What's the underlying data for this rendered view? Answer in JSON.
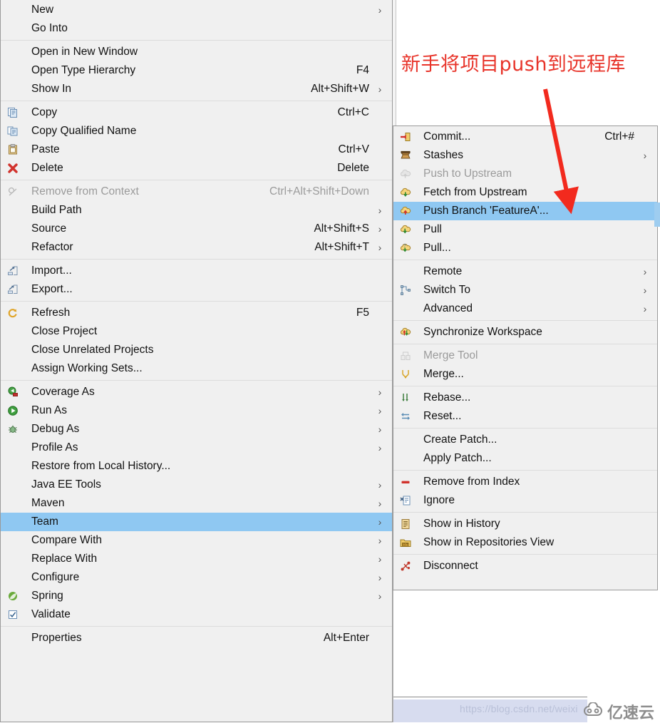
{
  "annotation": {
    "text": "新手将项目push到远程库",
    "color": "#e8342a"
  },
  "colors": {
    "menu_bg": "#f0f0f0",
    "menu_border": "#9a9a9a",
    "highlight": "#8fc8f2",
    "separator": "#dcdcdc",
    "disabled_text": "#9b9b9b",
    "text": "#111111",
    "annotation_red": "#e8342a",
    "status_strip": "#d7dcef",
    "watermark": "#b9c0d8"
  },
  "context_menu": {
    "name": "project-context-menu",
    "items": [
      {
        "label": "New",
        "accel": "",
        "submenu": true,
        "icon": "",
        "disabled": false,
        "selected": false
      },
      {
        "label": "Go Into",
        "accel": "",
        "submenu": false,
        "icon": "",
        "disabled": false,
        "selected": false
      },
      {
        "separator": true
      },
      {
        "label": "Open in New Window",
        "accel": "",
        "submenu": false,
        "icon": "",
        "disabled": false,
        "selected": false
      },
      {
        "label": "Open Type Hierarchy",
        "accel": "F4",
        "submenu": false,
        "icon": "",
        "disabled": false,
        "selected": false
      },
      {
        "label": "Show In",
        "accel": "Alt+Shift+W",
        "submenu": true,
        "icon": "",
        "disabled": false,
        "selected": false
      },
      {
        "separator": true
      },
      {
        "label": "Copy",
        "accel": "Ctrl+C",
        "submenu": false,
        "icon": "copy-icon",
        "disabled": false,
        "selected": false
      },
      {
        "label": "Copy Qualified Name",
        "accel": "",
        "submenu": false,
        "icon": "copy-qualified-icon",
        "disabled": false,
        "selected": false
      },
      {
        "label": "Paste",
        "accel": "Ctrl+V",
        "submenu": false,
        "icon": "paste-icon",
        "disabled": false,
        "selected": false
      },
      {
        "label": "Delete",
        "accel": "Delete",
        "submenu": false,
        "icon": "delete-x-icon",
        "disabled": false,
        "selected": false
      },
      {
        "separator": true
      },
      {
        "label": "Remove from Context",
        "accel": "Ctrl+Alt+Shift+Down",
        "submenu": false,
        "icon": "remove-context-icon",
        "disabled": true,
        "selected": false
      },
      {
        "label": "Build Path",
        "accel": "",
        "submenu": true,
        "icon": "",
        "disabled": false,
        "selected": false
      },
      {
        "label": "Source",
        "accel": "Alt+Shift+S",
        "submenu": true,
        "icon": "",
        "disabled": false,
        "selected": false
      },
      {
        "label": "Refactor",
        "accel": "Alt+Shift+T",
        "submenu": true,
        "icon": "",
        "disabled": false,
        "selected": false
      },
      {
        "separator": true
      },
      {
        "label": "Import...",
        "accel": "",
        "submenu": false,
        "icon": "import-icon",
        "disabled": false,
        "selected": false
      },
      {
        "label": "Export...",
        "accel": "",
        "submenu": false,
        "icon": "export-icon",
        "disabled": false,
        "selected": false
      },
      {
        "separator": true
      },
      {
        "label": "Refresh",
        "accel": "F5",
        "submenu": false,
        "icon": "refresh-icon",
        "disabled": false,
        "selected": false
      },
      {
        "label": "Close Project",
        "accel": "",
        "submenu": false,
        "icon": "",
        "disabled": false,
        "selected": false
      },
      {
        "label": "Close Unrelated Projects",
        "accel": "",
        "submenu": false,
        "icon": "",
        "disabled": false,
        "selected": false
      },
      {
        "label": "Assign Working Sets...",
        "accel": "",
        "submenu": false,
        "icon": "",
        "disabled": false,
        "selected": false
      },
      {
        "separator": true
      },
      {
        "label": "Coverage As",
        "accel": "",
        "submenu": true,
        "icon": "coverage-icon",
        "disabled": false,
        "selected": false
      },
      {
        "label": "Run As",
        "accel": "",
        "submenu": true,
        "icon": "run-icon",
        "disabled": false,
        "selected": false
      },
      {
        "label": "Debug As",
        "accel": "",
        "submenu": true,
        "icon": "debug-bug-icon",
        "disabled": false,
        "selected": false
      },
      {
        "label": "Profile As",
        "accel": "",
        "submenu": true,
        "icon": "",
        "disabled": false,
        "selected": false
      },
      {
        "label": "Restore from Local History...",
        "accel": "",
        "submenu": false,
        "icon": "",
        "disabled": false,
        "selected": false
      },
      {
        "label": "Java EE Tools",
        "accel": "",
        "submenu": true,
        "icon": "",
        "disabled": false,
        "selected": false
      },
      {
        "label": "Maven",
        "accel": "",
        "submenu": true,
        "icon": "",
        "disabled": false,
        "selected": false
      },
      {
        "label": "Team",
        "accel": "",
        "submenu": true,
        "icon": "",
        "disabled": false,
        "selected": true
      },
      {
        "label": "Compare With",
        "accel": "",
        "submenu": true,
        "icon": "",
        "disabled": false,
        "selected": false
      },
      {
        "label": "Replace With",
        "accel": "",
        "submenu": true,
        "icon": "",
        "disabled": false,
        "selected": false
      },
      {
        "label": "Configure",
        "accel": "",
        "submenu": true,
        "icon": "",
        "disabled": false,
        "selected": false
      },
      {
        "label": "Spring",
        "accel": "",
        "submenu": true,
        "icon": "spring-leaf-icon",
        "disabled": false,
        "selected": false
      },
      {
        "label": "Validate",
        "accel": "",
        "submenu": false,
        "icon": "validate-check-icon",
        "disabled": false,
        "selected": false
      },
      {
        "separator": true
      },
      {
        "label": "Properties",
        "accel": "Alt+Enter",
        "submenu": false,
        "icon": "",
        "disabled": false,
        "selected": false
      }
    ]
  },
  "team_submenu": {
    "name": "team-submenu",
    "items": [
      {
        "label": "Commit...",
        "accel": "Ctrl+#",
        "submenu": false,
        "icon": "commit-icon",
        "disabled": false,
        "selected": false
      },
      {
        "label": "Stashes",
        "accel": "",
        "submenu": true,
        "icon": "stash-box-icon",
        "disabled": false,
        "selected": false
      },
      {
        "label": "Push to Upstream",
        "accel": "",
        "submenu": false,
        "icon": "push-upstream-icon",
        "disabled": true,
        "selected": false
      },
      {
        "label": "Fetch from Upstream",
        "accel": "",
        "submenu": false,
        "icon": "fetch-icon",
        "disabled": false,
        "selected": false
      },
      {
        "label": "Push Branch 'FeatureA'...",
        "accel": "",
        "submenu": false,
        "icon": "push-branch-icon",
        "disabled": false,
        "selected": true
      },
      {
        "label": "Pull",
        "accel": "",
        "submenu": false,
        "icon": "pull-icon",
        "disabled": false,
        "selected": false
      },
      {
        "label": "Pull...",
        "accel": "",
        "submenu": false,
        "icon": "pull-options-icon",
        "disabled": false,
        "selected": false
      },
      {
        "separator": true
      },
      {
        "label": "Remote",
        "accel": "",
        "submenu": true,
        "icon": "",
        "disabled": false,
        "selected": false
      },
      {
        "label": "Switch To",
        "accel": "",
        "submenu": true,
        "icon": "switch-branch-icon",
        "disabled": false,
        "selected": false
      },
      {
        "label": "Advanced",
        "accel": "",
        "submenu": true,
        "icon": "",
        "disabled": false,
        "selected": false
      },
      {
        "separator": true
      },
      {
        "label": "Synchronize Workspace",
        "accel": "",
        "submenu": false,
        "icon": "synchronize-icon",
        "disabled": false,
        "selected": false
      },
      {
        "separator": true
      },
      {
        "label": "Merge Tool",
        "accel": "",
        "submenu": false,
        "icon": "merge-tool-icon",
        "disabled": true,
        "selected": false
      },
      {
        "label": "Merge...",
        "accel": "",
        "submenu": false,
        "icon": "merge-icon",
        "disabled": false,
        "selected": false
      },
      {
        "separator": true
      },
      {
        "label": "Rebase...",
        "accel": "",
        "submenu": false,
        "icon": "rebase-icon",
        "disabled": false,
        "selected": false
      },
      {
        "label": "Reset...",
        "accel": "",
        "submenu": false,
        "icon": "reset-icon",
        "disabled": false,
        "selected": false
      },
      {
        "separator": true
      },
      {
        "label": "Create Patch...",
        "accel": "",
        "submenu": false,
        "icon": "",
        "disabled": false,
        "selected": false
      },
      {
        "label": "Apply Patch...",
        "accel": "",
        "submenu": false,
        "icon": "",
        "disabled": false,
        "selected": false
      },
      {
        "separator": true
      },
      {
        "label": "Remove from Index",
        "accel": "",
        "submenu": false,
        "icon": "remove-index-icon",
        "disabled": false,
        "selected": false
      },
      {
        "label": "Ignore",
        "accel": "",
        "submenu": false,
        "icon": "ignore-icon",
        "disabled": false,
        "selected": false
      },
      {
        "separator": true
      },
      {
        "label": "Show in History",
        "accel": "",
        "submenu": false,
        "icon": "history-icon",
        "disabled": false,
        "selected": false
      },
      {
        "label": "Show in Repositories View",
        "accel": "",
        "submenu": false,
        "icon": "repositories-icon",
        "disabled": false,
        "selected": false
      },
      {
        "separator": true
      },
      {
        "label": "Disconnect",
        "accel": "",
        "submenu": false,
        "icon": "disconnect-icon",
        "disabled": false,
        "selected": false
      }
    ]
  },
  "watermark": {
    "url_text": "https://blog.csdn.net/weixi",
    "logo_text": "亿速云"
  }
}
